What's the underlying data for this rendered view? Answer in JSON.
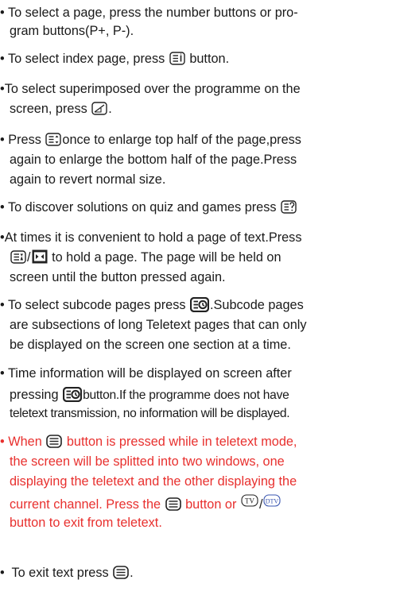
{
  "bullet": "•",
  "colors": {
    "text": "#1a1a1a",
    "highlight": "#e8302e",
    "icon_dark": "#222222",
    "icon_blue": "#3a56b0"
  },
  "items": [
    {
      "l1": "To select a page, press the number buttons or pro-",
      "l2": "gram buttons(P+, P-)."
    },
    {
      "a": "To select index page, press",
      "b": "button."
    },
    {
      "l1": "To select superimposed over the programme on the",
      "l2": "screen, press",
      "end": "."
    },
    {
      "a": "Press",
      "b": "once to enlarge top half of the page,press",
      "l2": "again to enlarge the bottom half of the page.Press",
      "l3": "again to revert normal size."
    },
    {
      "a": "To discover solutions on quiz and games press"
    },
    {
      "l1": "At times it is convenient to hold a page of text.Press",
      "sep": "/",
      "b": "to hold a page. The page will be held on",
      "l3": "screen until the button pressed again."
    },
    {
      "a": "To select subcode pages press",
      "b": ".Subcode pages",
      "l2": "are subsections of long Teletext pages that can only",
      "l3": "be displayed on the screen one section at a time."
    },
    {
      "l1": "Time information will be displayed on screen after",
      "a": "pressing",
      "b": "button.If the programme does not have",
      "l3": "teletext transmission, no information will be displayed."
    },
    {
      "a": "When",
      "b": "button is pressed while in teletext mode,",
      "l2": "the screen will be splitted into two windows, one",
      "l3": "displaying the teletext and the other displaying the",
      "c": "current channel. Press the",
      "d": "button or",
      "sep": "/",
      "l5": "button to exit from teletext."
    },
    {
      "a": "To exit text press",
      "end": "."
    }
  ],
  "icons": {
    "index": "index-icon",
    "mix": "mix-icon",
    "size": "size-icon",
    "reveal": "reveal-icon",
    "hold": "hold-icon",
    "hold_alt": "hold-square-icon",
    "subcode": "subcode-icon",
    "text": "text-icon",
    "tv": "tv-icon",
    "dtv": "dtv-icon"
  }
}
